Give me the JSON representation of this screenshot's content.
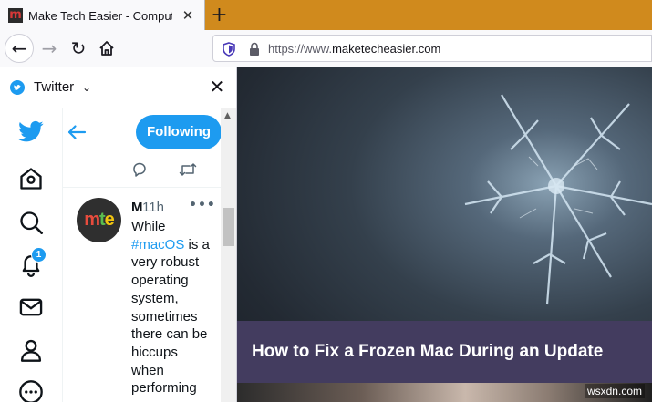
{
  "browser": {
    "tab": {
      "title": "Make Tech Easier - Computer Tricks",
      "favicon_letter": "m",
      "close_glyph": "✕"
    },
    "new_tab_glyph": "+",
    "nav": {
      "back": "←",
      "forward": "→",
      "reload": "↻"
    },
    "url": {
      "scheme": "https://www.",
      "host": "maketecheasier.com"
    },
    "tab_strip_color": "#d08a1d"
  },
  "sidebar": {
    "title": "Twitter",
    "chevron": "⌄",
    "close": "✕",
    "nav_icons": [
      "twitter-bird-icon",
      "home-icon",
      "search-icon",
      "notifications-icon",
      "messages-icon",
      "profile-icon",
      "more-icon"
    ],
    "notification_count": "1",
    "feed": {
      "following_label": "Following",
      "tweet": {
        "avatar_letters": [
          "m",
          "t",
          "e"
        ],
        "author": "M",
        "time": "11h",
        "more": "•••",
        "text_lines": [
          "While",
          "#macOS is a",
          "very robust",
          "operating",
          "system,",
          "sometimes",
          "there can be",
          "hiccups",
          "when",
          "performing"
        ],
        "hashtag": "#macOS",
        "hashtag_suffix": " is a"
      }
    },
    "accent_color": "#1d9bf0"
  },
  "content": {
    "headline": "How to Fix a Frozen Mac During an Update",
    "headline_bg": "#433c5f",
    "watermark": "wsxdn.com"
  }
}
